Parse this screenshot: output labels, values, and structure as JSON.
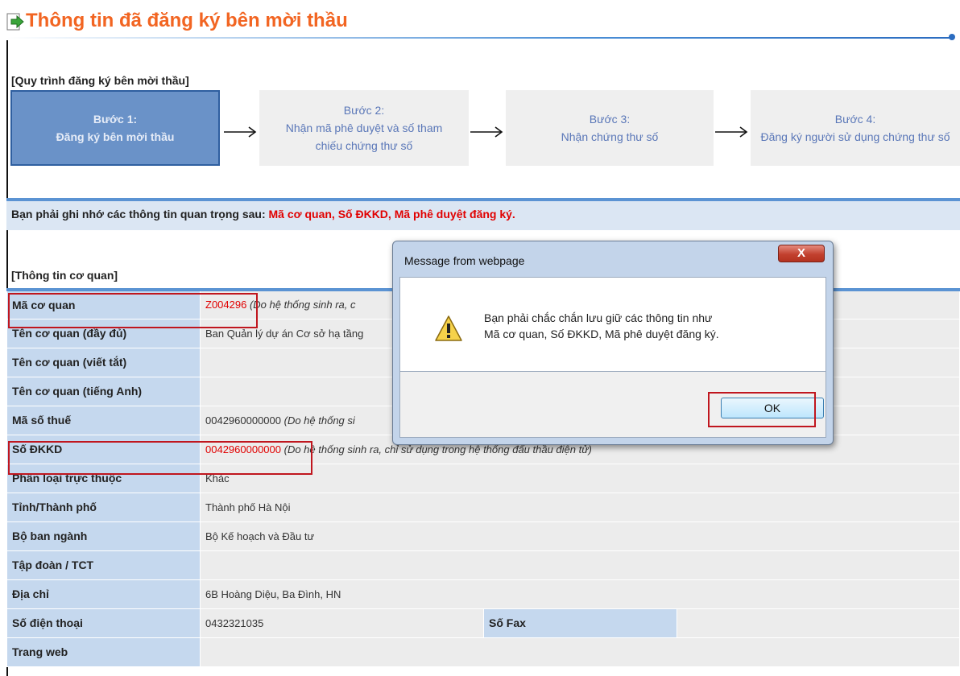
{
  "page": {
    "title": "Thông tin đã đăng ký bên mời thầu",
    "process_title": "[Quy trình đăng ký bên mời thầu]",
    "steps": [
      {
        "label": "Bước 1:",
        "text": "Đăng ký bên mời thầu",
        "active": true
      },
      {
        "label": "Bước 2:",
        "text": "Nhận mã phê duyệt và số tham chiếu chứng thư số",
        "active": false
      },
      {
        "label": "Bước 3:",
        "text": "Nhận chứng thư số",
        "active": false
      },
      {
        "label": "Bước 4:",
        "text": "Đăng ký người sử dụng chứng thư số",
        "active": false
      }
    ],
    "notice_prefix": "Bạn phải ghi nhớ các thông tin quan trọng sau: ",
    "notice_emphasis": "Mã cơ quan, Số ĐKKD, Mã phê duyệt đăng ký.",
    "section_title": "[Thông tin cơ quan]"
  },
  "info": {
    "ma_co_quan_label": "Mã cơ quan",
    "ma_co_quan_value": "Z004296",
    "ma_co_quan_note": "(Do hệ thống sinh ra, c",
    "ten_day_du_label": "Tên cơ quan (đầy đủ)",
    "ten_day_du_value": "Ban Quản lý dự án Cơ sở hạ tầng",
    "ten_viet_tat_label": "Tên cơ quan (viết tắt)",
    "ten_viet_tat_value": "",
    "ten_tieng_anh_label": "Tên cơ quan (tiếng Anh)",
    "ten_tieng_anh_value": "",
    "ma_so_thue_label": "Mã số thuế",
    "ma_so_thue_value": "0042960000000",
    "ma_so_thue_note": "(Do hệ thống si",
    "so_dkkd_label": "Số ĐKKD",
    "so_dkkd_value": "0042960000000",
    "so_dkkd_note": "(Do hệ thống sinh ra, chỉ sử dụng trong hệ thống đấu thầu điện tử)",
    "phan_loai_label": "Phân loại trực thuộc",
    "phan_loai_value": "Khác",
    "tinh_label": "Tỉnh/Thành phố",
    "tinh_value": "Thành phố Hà Nội",
    "bo_label": "Bộ ban ngành",
    "bo_value": "Bộ Kế hoạch và Đầu tư",
    "tap_doan_label": "Tập đoàn / TCT",
    "tap_doan_value": "",
    "dia_chi_label": "Địa chỉ",
    "dia_chi_value": "6B Hoàng Diệu, Ba Đình, HN",
    "dien_thoai_label": "Số điện thoại",
    "dien_thoai_value": "0432321035",
    "fax_label": "Số Fax",
    "fax_value": "",
    "web_label": "Trang web",
    "web_value": ""
  },
  "dialog": {
    "title": "Message from webpage",
    "close_label": "X",
    "message_line1": "Bạn phải chắc chắn lưu giữ các thông tin như",
    "message_line2": "Mã cơ quan, Số ĐKKD, Mã phê duyệt đăng ký.",
    "ok_label": "OK"
  },
  "colors": {
    "title_orange": "#f26522",
    "accent_blue": "#5b93d3",
    "label_bg": "#c5d8ee",
    "highlight_red": "#e10000"
  }
}
